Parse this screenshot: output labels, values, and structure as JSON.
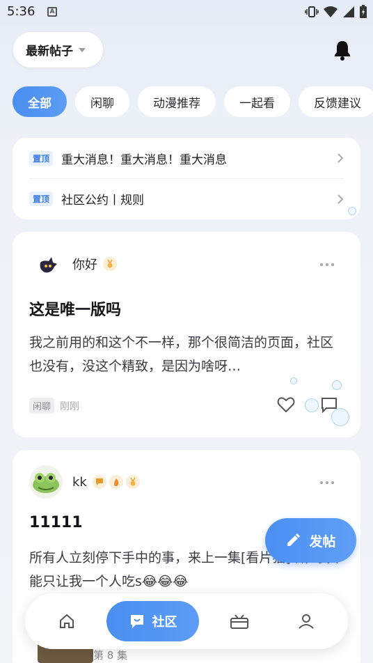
{
  "status_bar": {
    "time": "5:36"
  },
  "header": {
    "sort_label": "最新帖子"
  },
  "tabs": [
    "全部",
    "闲聊",
    "动漫推荐",
    "一起看",
    "反馈建议"
  ],
  "pinned": [
    {
      "badge": "置顶",
      "title": "重大消息！重大消息！重大消息"
    },
    {
      "badge": "置顶",
      "title": "社区公约丨规则"
    }
  ],
  "posts": [
    {
      "author": "你好",
      "title": "这是唯一版吗",
      "body": "我之前用的和这个不一样，那个很简洁的页面，社区也没有，没这个精致，是因为啥呀…",
      "tag": "闲聊",
      "time": "刚刚"
    },
    {
      "author": "kk",
      "title": "11111",
      "body": "所有人立刻停下手中的事，来上一集[看片猫]喵，我不能只让我一个人吃s😂😂😂",
      "episode": "第 8 集"
    }
  ],
  "fab": {
    "label": "发帖"
  },
  "bottom_nav": {
    "active_label": "社区"
  },
  "colors": {
    "accent": "#4a8ef0",
    "background": "#eef1f7"
  }
}
